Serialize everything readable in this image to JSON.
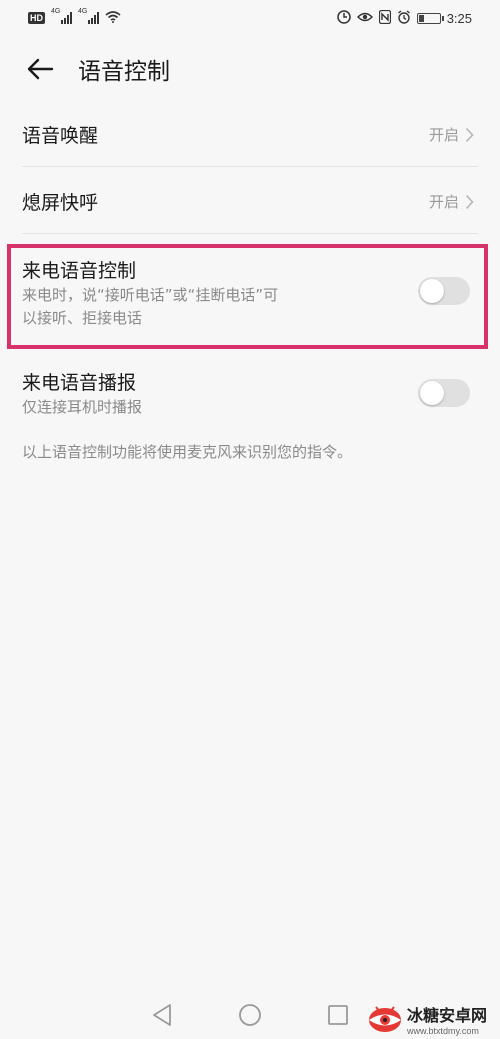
{
  "status_bar": {
    "hd": "HD",
    "net1": "4G",
    "net2": "4G",
    "time": "3:25",
    "battery_level": 0.3
  },
  "header": {
    "title": "语音控制"
  },
  "rows": [
    {
      "title": "语音唤醒",
      "value": "开启"
    },
    {
      "title": "熄屏快呼",
      "value": "开启"
    },
    {
      "title": "来电语音控制",
      "subtitle_line1": "来电时，说“接听电话”或“挂断电话”可",
      "subtitle_line2": "以接听、拒接电话",
      "toggle": "off"
    },
    {
      "title": "来电语音播报",
      "subtitle_line1": "仅连接耳机时播报",
      "toggle": "off"
    }
  ],
  "footer_note": "以上语音控制功能将使用麦克风来识别您的指令。",
  "watermark": {
    "name": "冰糖安卓网",
    "url": "www.btxtdmy.com"
  },
  "colors": {
    "highlight": "#d6336c",
    "toggle_off": "#e0e0e0"
  }
}
